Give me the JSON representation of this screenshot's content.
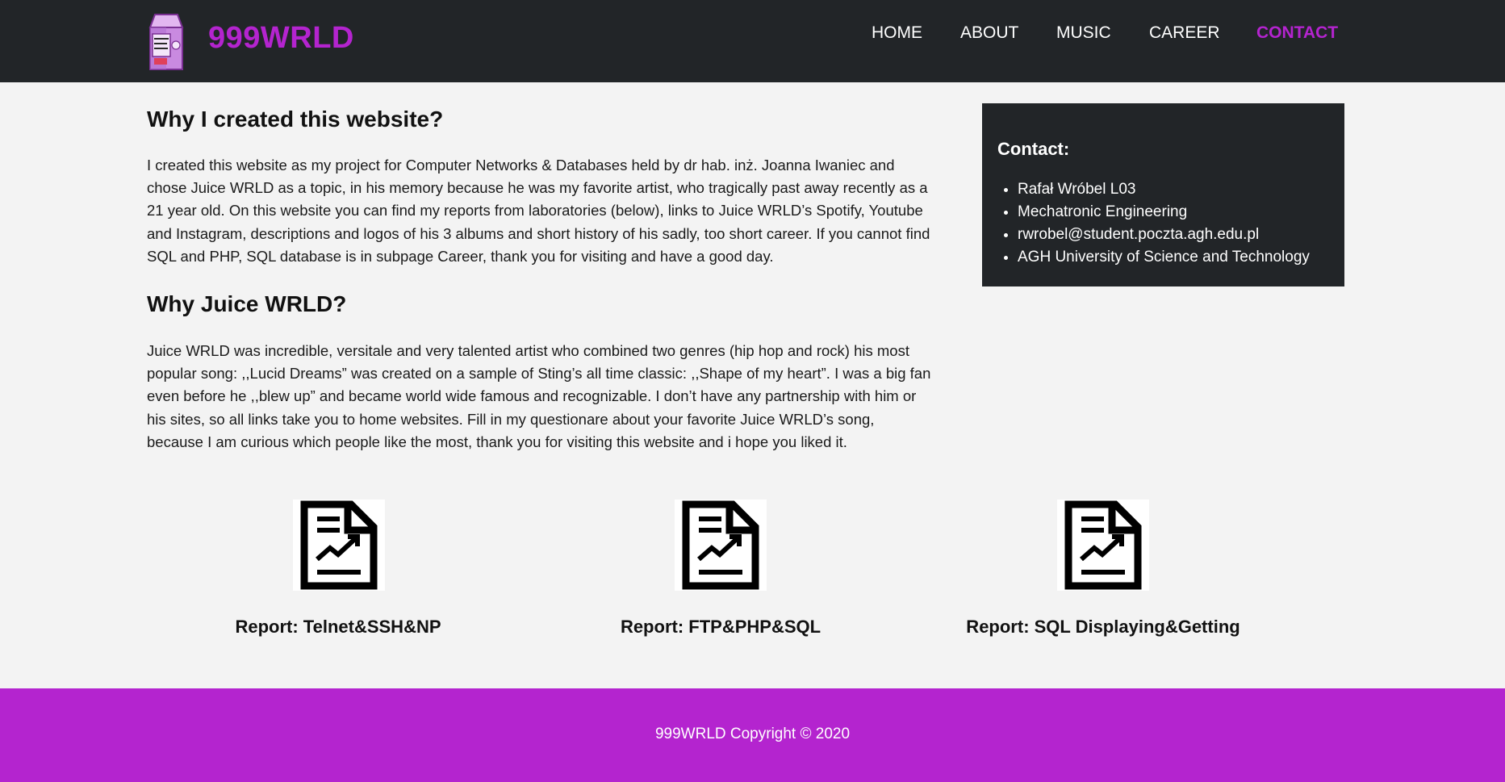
{
  "brand": {
    "name": "999WRLD",
    "logo_icon": "juice-carton-icon",
    "color": "#b424cf"
  },
  "nav": {
    "items": [
      {
        "label": "HOME",
        "active": false
      },
      {
        "label": "ABOUT",
        "active": false
      },
      {
        "label": "MUSIC",
        "active": false
      },
      {
        "label": "CAREER",
        "active": false
      },
      {
        "label": "CONTACT",
        "active": true
      }
    ]
  },
  "main": {
    "section1": {
      "heading": "Why I created this website?",
      "text": "I created this website as my project for Computer Networks & Databases held by dr hab. inż. Joanna Iwaniec and chose Juice WRLD as a topic, in his memory because he was my favorite artist, who tragically past away recently as a 21 year old. On this website you can find my reports from laboratories (below), links to Juice WRLD’s Spotify, Youtube and Instagram, descriptions and logos of his 3 albums and short history of his sadly, too short career. If you cannot find SQL and PHP, SQL database is in subpage Career, thank you for visiting and have a good day."
    },
    "section2": {
      "heading": "Why Juice WRLD?",
      "text": "Juice WRLD was incredible, versitale and very talented artist who combined two genres (hip hop and rock) his most popular song: ,,Lucid Dreams” was created on a sample of Sting’s all time classic: ,,Shape of my heart”. I was a big fan even before he ,,blew up” and became world wide famous and recognizable. I don’t have any partnership with him or his sites, so all links take you to home websites. Fill in my questionare about your favorite Juice WRLD’s song, because I am curious which people like the most, thank you for visiting this website and i hope you liked it."
    }
  },
  "contact": {
    "title": "Contact:",
    "items": [
      "Rafał Wróbel L03",
      "Mechatronic Engineering",
      "rwrobel@student.poczta.agh.edu.pl",
      "AGH University of Science and Technology"
    ]
  },
  "reports": [
    {
      "label": "Report: Telnet&SSH&NP",
      "icon": "report-chart-icon"
    },
    {
      "label": "Report: FTP&PHP&SQL",
      "icon": "report-chart-icon"
    },
    {
      "label": "Report: SQL Displaying&Getting",
      "icon": "report-chart-icon"
    }
  ],
  "footer": {
    "text": "999WRLD Copyright © 2020"
  },
  "colors": {
    "header_bg": "#222528",
    "accent": "#b424cf",
    "page_bg": "#f3f3f3"
  }
}
